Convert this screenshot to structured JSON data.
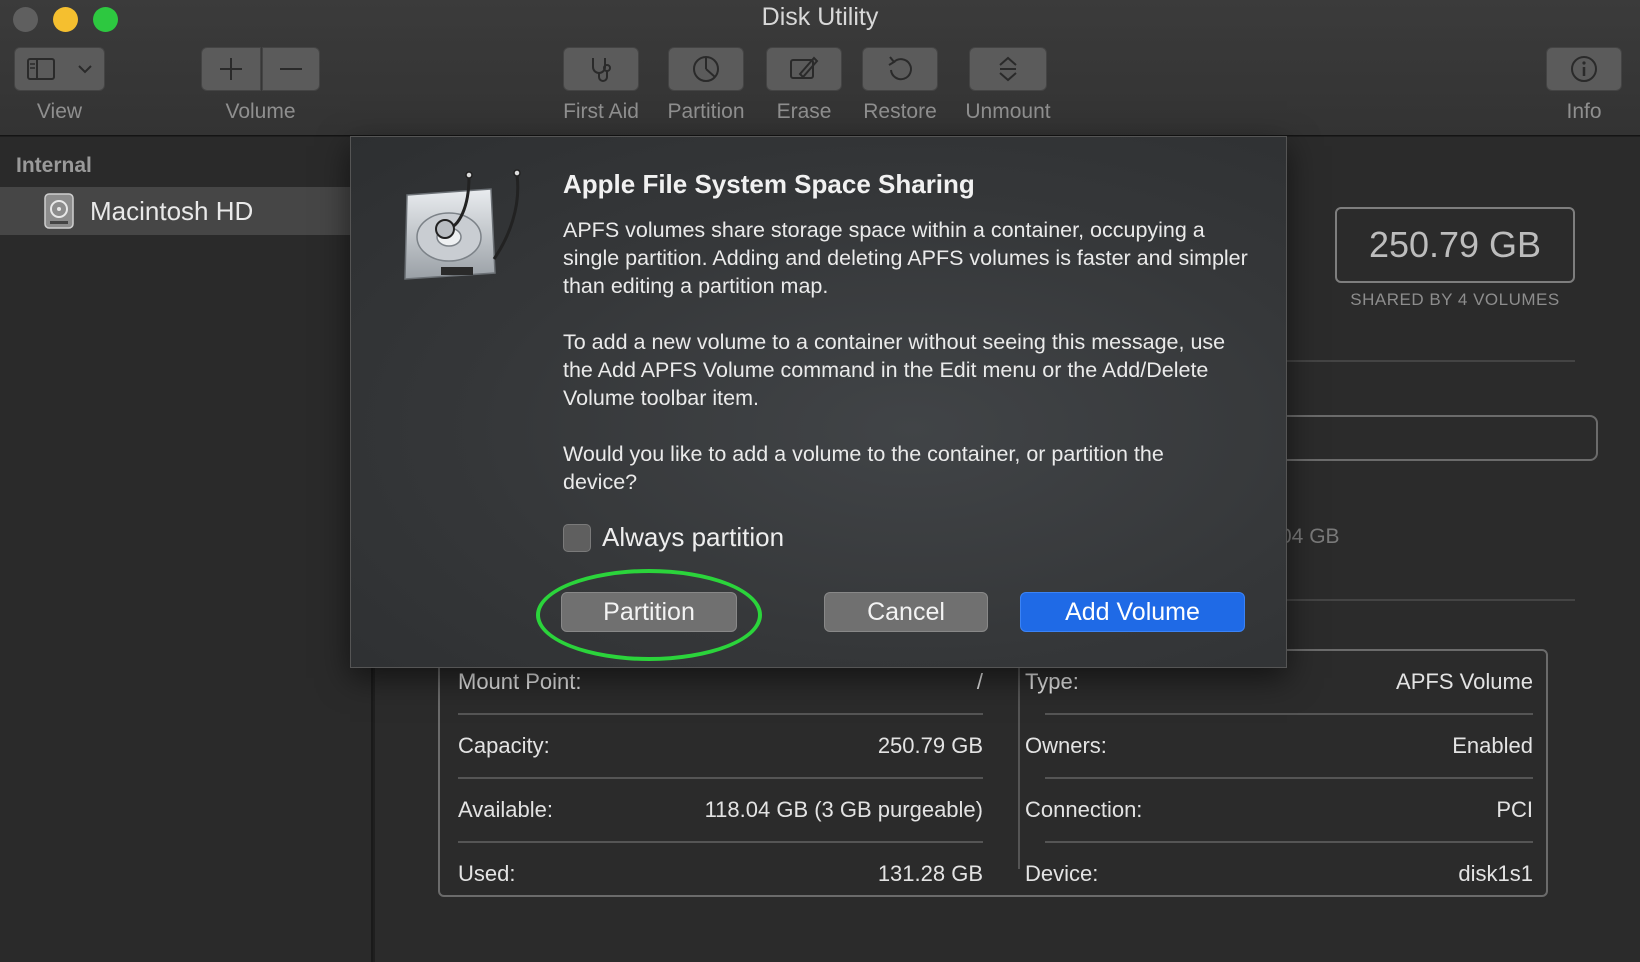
{
  "window": {
    "title": "Disk Utility",
    "traffic_lights": {
      "close": "#5f5f5f",
      "minimize": "#f5bf2f",
      "zoom": "#2dc840"
    }
  },
  "toolbar": {
    "view_label": "View",
    "volume_label": "Volume",
    "first_aid_label": "First Aid",
    "partition_label": "Partition",
    "erase_label": "Erase",
    "restore_label": "Restore",
    "unmount_label": "Unmount",
    "info_label": "Info",
    "icons": [
      "sidebar-icon",
      "chevron-down-icon",
      "plus-icon",
      "minus-icon",
      "stethoscope-icon",
      "pie-icon",
      "eraser-icon",
      "restore-icon",
      "eject-icon",
      "info-icon"
    ]
  },
  "sidebar": {
    "header": "Internal",
    "items": [
      {
        "label": "Macintosh HD",
        "icon": "hard-drive-icon",
        "selected": true
      }
    ]
  },
  "main": {
    "capacity_value": "250.79 GB",
    "capacity_caption": "SHARED BY 4 VOLUMES",
    "partially_hidden_value": "04 GB",
    "info": {
      "left": [
        {
          "label": "Mount Point:",
          "value": "/"
        },
        {
          "label": "Capacity:",
          "value": "250.79 GB"
        },
        {
          "label": "Available:",
          "value": "118.04 GB (3 GB purgeable)"
        },
        {
          "label": "Used:",
          "value": "131.28 GB"
        }
      ],
      "right": [
        {
          "label": "Type:",
          "value": "APFS Volume"
        },
        {
          "label": "Owners:",
          "value": "Enabled"
        },
        {
          "label": "Connection:",
          "value": "PCI"
        },
        {
          "label": "Device:",
          "value": "disk1s1"
        }
      ]
    }
  },
  "dialog": {
    "icon": "disk-stethoscope-icon",
    "title": "Apple File System Space Sharing",
    "paragraph1": "APFS volumes share storage space within a container, occupying a single partition. Adding and deleting APFS volumes is faster and simpler than editing a partition map.",
    "paragraph2": "To add a new volume to a container without seeing this message, use the Add APFS Volume command in the Edit menu or the Add/Delete Volume toolbar item.",
    "paragraph3": "Would you like to add a volume to the container, or partition the device?",
    "checkbox_label": "Always partition",
    "checkbox_checked": false,
    "partition_button": "Partition",
    "cancel_button": "Cancel",
    "add_volume_button": "Add Volume",
    "highlight_color": "#2bd43b",
    "default_button_color": "#1f6ae6"
  }
}
